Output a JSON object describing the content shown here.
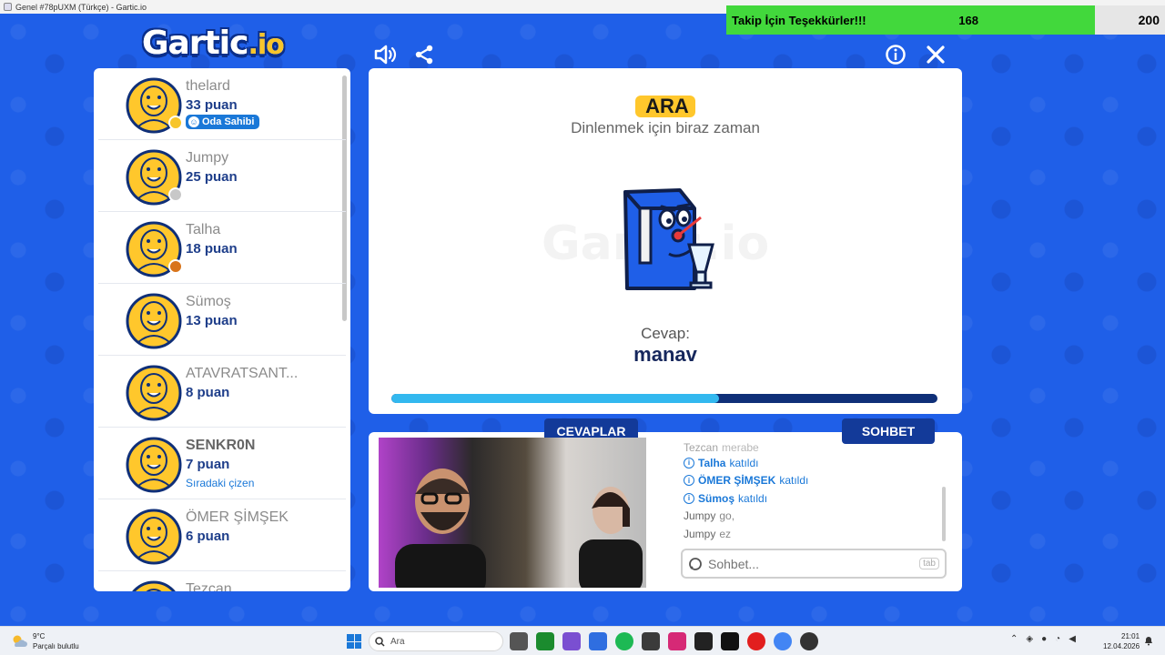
{
  "window": {
    "title": "Genel #78pUXM (Türkçe) - Gartic.io"
  },
  "overlay": {
    "message": "Takip İçin Teşekkürler!!!",
    "current": "168",
    "goal": "200",
    "progress_fraction": 0.84
  },
  "logo": {
    "text": "Gartic",
    "suffix": ".io"
  },
  "players": [
    {
      "name": "thelard",
      "score": "33 puan",
      "badge": "Oda Sahibi",
      "rank_color": "#f7c52b"
    },
    {
      "name": "Jumpy",
      "score": "25 puan",
      "rank_color": "#c8c8c8"
    },
    {
      "name": "Talha",
      "score": "18 puan",
      "rank_color": "#d8741a"
    },
    {
      "name": "Sümoş",
      "score": "13 puan"
    },
    {
      "name": "ATAVRATSANT...",
      "score": "8 puan"
    },
    {
      "name": "SENKR0N",
      "score": "7 puan",
      "sub": "Sıradaki çizen",
      "bold_name": true
    },
    {
      "name": "ÖMER ŞİMŞEK",
      "score": "6 puan"
    },
    {
      "name": "Tezcan",
      "score": ""
    }
  ],
  "round": {
    "tag": "ARA",
    "subtitle": "Dinlenmek için biraz zaman",
    "watermark": "Gartic.io",
    "answer_label": "Cevap:",
    "answer": "manav",
    "progress_fraction": 0.6
  },
  "tabs": {
    "answers": "CEVAPLAR",
    "chat": "SOHBET"
  },
  "chat": {
    "lines": [
      {
        "type": "msg",
        "user": "Tezcan",
        "text": "merabe"
      },
      {
        "type": "sys",
        "user": "Talha",
        "text": "katıldı"
      },
      {
        "type": "sys",
        "user": "ÖMER ŞİMŞEK",
        "text": "katıldı"
      },
      {
        "type": "sys",
        "user": "Sümoş",
        "text": "katıldı"
      },
      {
        "type": "msg",
        "user": "Jumpy",
        "text": "go,"
      },
      {
        "type": "msg",
        "user": "Jumpy",
        "text": "ez"
      }
    ],
    "placeholder": "Sohbet...",
    "tab_hint": "tab"
  },
  "taskbar": {
    "temp": "9°C",
    "weather": "Parçalı bulutlu",
    "search": "Ara",
    "time": "21:01",
    "date": "12.04.2026"
  },
  "colors": {
    "brand_blue": "#1f5fe8",
    "accent_yellow": "#ffc72c",
    "navy": "#133a99"
  }
}
